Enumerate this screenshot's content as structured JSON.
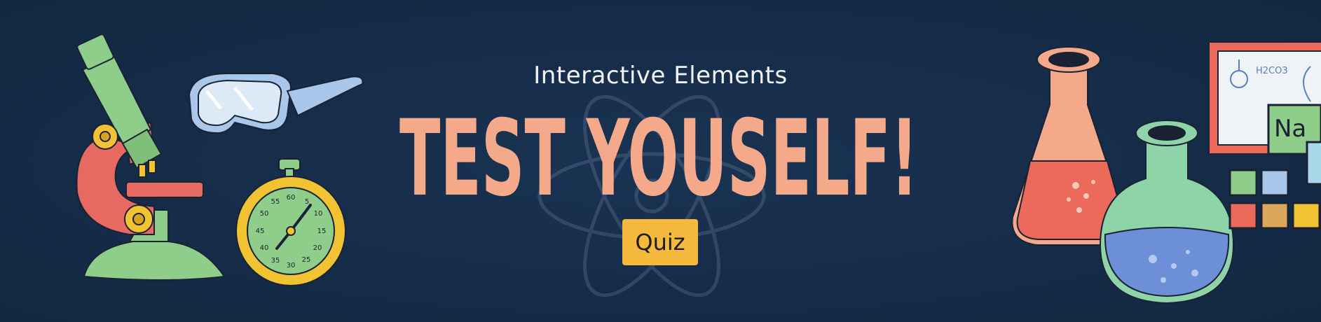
{
  "banner": {
    "subtitle": "Interactive Elements",
    "headline": "TEST YOUSELF!",
    "quiz_label": "Quiz"
  },
  "stopwatch": {
    "dial_numbers": [
      "60",
      "5",
      "10",
      "15",
      "20",
      "25",
      "30",
      "35",
      "40",
      "45",
      "50",
      "55"
    ]
  },
  "chalkboard": {
    "formula": "H2CO3"
  },
  "element_tile": {
    "symbol": "Na"
  },
  "colors": {
    "background": "#152d4a",
    "headline": "#f4a98a",
    "button": "#f4b93d",
    "subtitle": "#f2f2f2"
  },
  "icons": [
    "microscope-icon",
    "safety-goggles-icon",
    "stopwatch-icon",
    "atom-icon",
    "erlenmeyer-flask-icon",
    "round-flask-icon",
    "periodic-table-icon",
    "chalkboard-icon"
  ]
}
